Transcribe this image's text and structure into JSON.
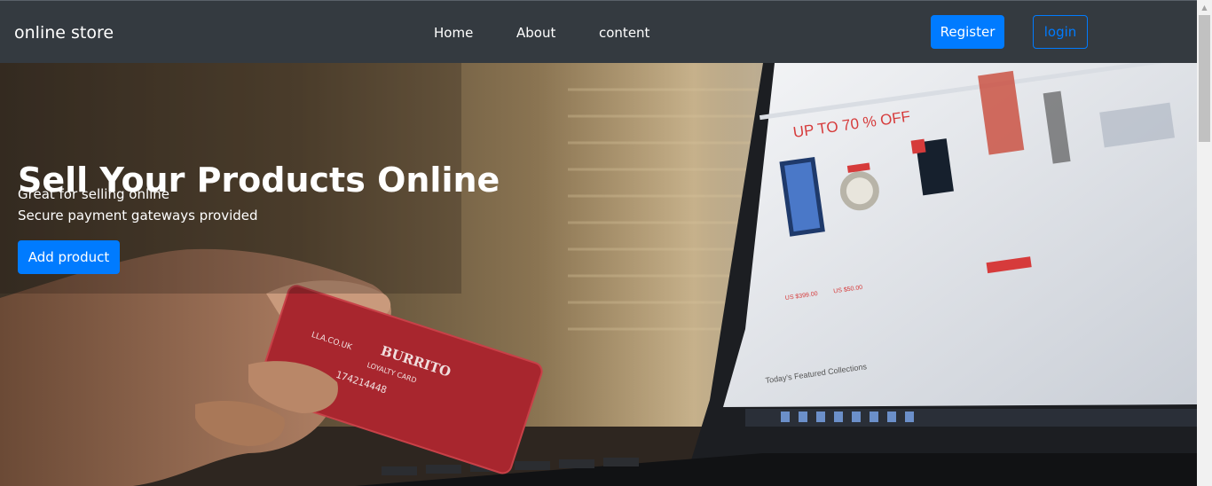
{
  "navbar": {
    "brand": "online store",
    "links": [
      "Home",
      "About",
      "content"
    ],
    "register_label": "Register",
    "login_label": "login"
  },
  "hero": {
    "title": "Sell Your Products Online",
    "line1": "Great for selling online",
    "line2": "Secure payment gateways provided",
    "button_label": "Add product"
  },
  "photo_text": {
    "sale_banner": "UP TO 70 % OFF",
    "price1": "US $399.00",
    "price2": "US $50.00",
    "featured": "Today's Featured Collections",
    "card_brand": "BURRITO",
    "card_type": "LOYALTY CARD",
    "card_number": "174214448",
    "card_site": "LLA.CO.UK"
  },
  "colors": {
    "navbar_bg": "#343a40",
    "primary": "#007bff",
    "text_light": "#ffffff"
  }
}
